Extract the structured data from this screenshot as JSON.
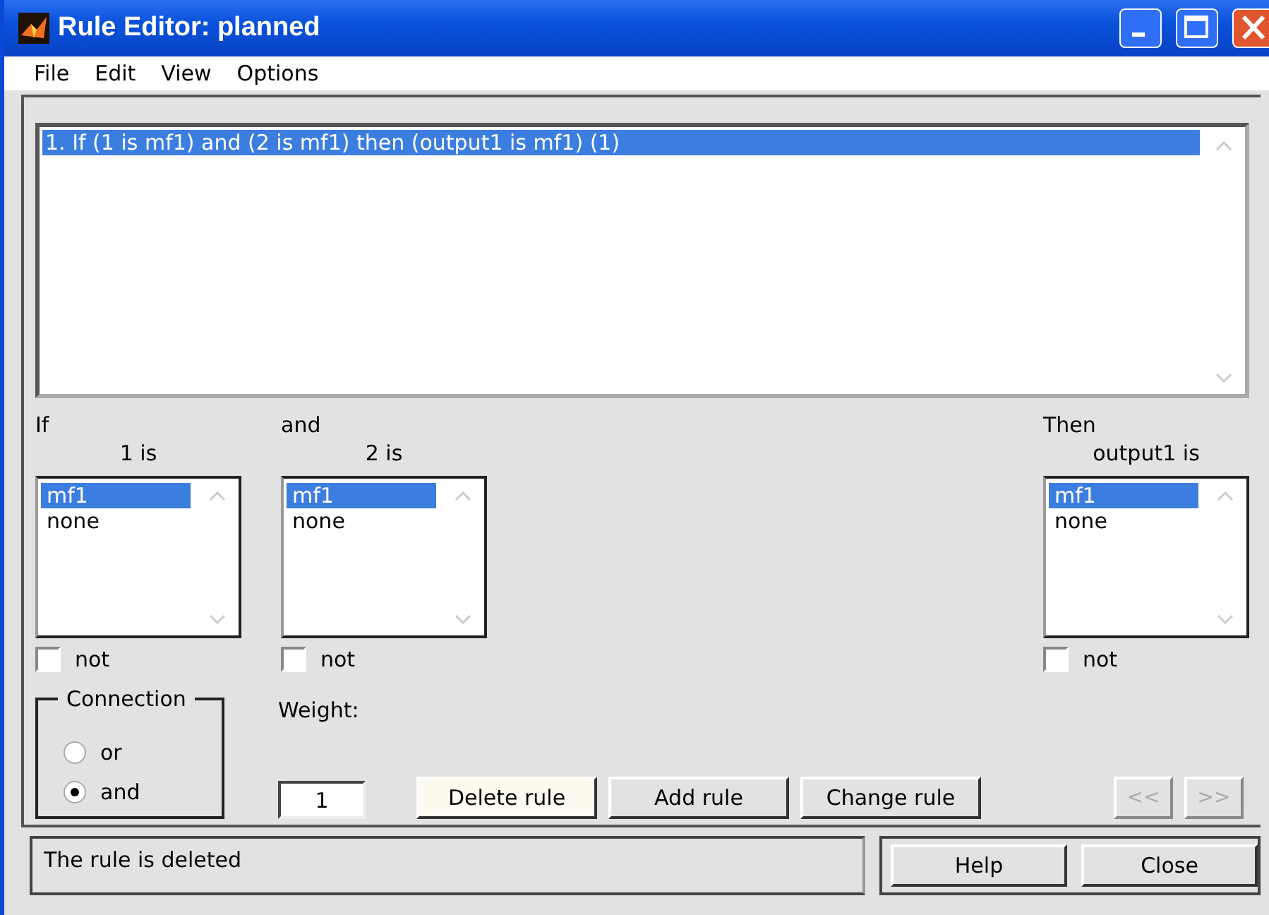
{
  "window": {
    "title": "Rule Editor: planned"
  },
  "menu": [
    "File",
    "Edit",
    "View",
    "Options"
  ],
  "rules": [
    {
      "text": "1. If (1 is mf1) and (2 is mf1) then (output1 is mf1) (1)",
      "selected": true
    }
  ],
  "variables": [
    {
      "heading": "If",
      "label": "1 is",
      "options": [
        {
          "text": "mf1",
          "selected": true
        },
        {
          "text": "none",
          "selected": false
        }
      ],
      "not_checked": false,
      "not_label": "not"
    },
    {
      "heading": "and",
      "label": "2 is",
      "options": [
        {
          "text": "mf1",
          "selected": true
        },
        {
          "text": "none",
          "selected": false
        }
      ],
      "not_checked": false,
      "not_label": "not"
    },
    {
      "heading": "Then",
      "label": "output1 is",
      "options": [
        {
          "text": "mf1",
          "selected": true
        },
        {
          "text": "none",
          "selected": false
        }
      ],
      "not_checked": false,
      "not_label": "not"
    }
  ],
  "connection": {
    "title": "Connection",
    "options": [
      {
        "label": "or",
        "selected": false
      },
      {
        "label": "and",
        "selected": true
      }
    ]
  },
  "weight": {
    "label": "Weight:",
    "value": "1"
  },
  "actions": [
    {
      "label": "Delete rule",
      "focused": true
    },
    {
      "label": "Add rule",
      "focused": false
    },
    {
      "label": "Change rule",
      "focused": false
    }
  ],
  "nav": [
    {
      "label": "<<",
      "disabled": true
    },
    {
      "label": ">>",
      "disabled": true
    }
  ],
  "status": "The rule is deleted",
  "footer_buttons": [
    "Help",
    "Close"
  ]
}
